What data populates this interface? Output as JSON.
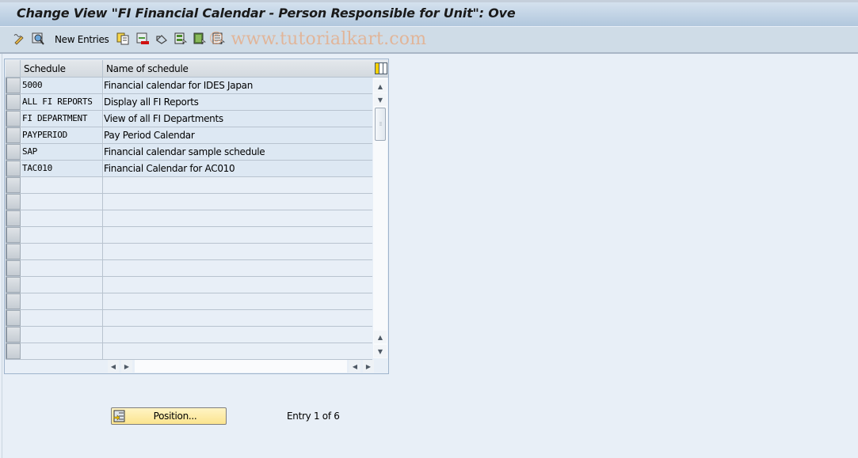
{
  "window": {
    "title": "Change View \"FI Financial Calendar - Person Responsible for Unit\": Ove"
  },
  "toolbar": {
    "items": [
      {
        "icon": "edit-display-toggle-icon"
      },
      {
        "icon": "detail-view-icon"
      },
      {
        "label": "New Entries"
      },
      {
        "icon": "copy-as-icon"
      },
      {
        "icon": "delete-icon"
      },
      {
        "icon": "undo-change-icon"
      },
      {
        "icon": "select-all-icon"
      },
      {
        "icon": "select-block-icon"
      },
      {
        "icon": "deselect-all-icon"
      }
    ],
    "new_entries_label": "New Entries",
    "watermark": "© www.tutorialkart.com"
  },
  "table": {
    "columns": [
      "Schedule",
      "Name of schedule"
    ],
    "rows": [
      {
        "schedule": "5000",
        "name": "Financial calendar for IDES Japan"
      },
      {
        "schedule": "ALL FI REPORTS",
        "name": "Display all FI Reports"
      },
      {
        "schedule": "FI DEPARTMENT",
        "name": "View of all FI Departments"
      },
      {
        "schedule": "PAYPERIOD",
        "name": "Pay Period Calendar"
      },
      {
        "schedule": "SAP",
        "name": "Financial calendar sample schedule"
      },
      {
        "schedule": "TAC010",
        "name": "Financial Calendar for AC010"
      }
    ],
    "empty_rows": 11
  },
  "footer": {
    "position_button": "Position...",
    "entry_info": "Entry 1 of 6"
  },
  "colors": {
    "title_bar": "#b1c7dd",
    "toolbar": "#cfdce7",
    "background": "#e8eff7",
    "button_yellow": "#fbe48f"
  }
}
